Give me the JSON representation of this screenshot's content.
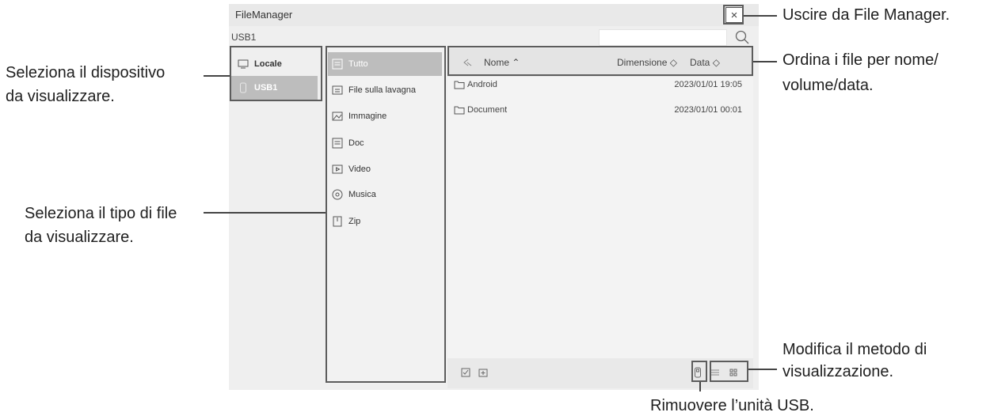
{
  "window": {
    "title": "FileManager",
    "close_label": "×",
    "path": "USB1"
  },
  "devices": [
    {
      "label": "Locale",
      "icon": "monitor-icon",
      "selected": false
    },
    {
      "label": "USB1",
      "icon": "usb-drive-icon",
      "selected": true
    }
  ],
  "categories": [
    {
      "label": "Tutto",
      "icon": "all-files-icon",
      "selected": true
    },
    {
      "label": "File sulla lavagna",
      "icon": "whiteboard-file-icon",
      "selected": false
    },
    {
      "label": "Immagine",
      "icon": "image-icon",
      "selected": false
    },
    {
      "label": "Doc",
      "icon": "doc-icon",
      "selected": false
    },
    {
      "label": "Video",
      "icon": "video-icon",
      "selected": false
    },
    {
      "label": "Musica",
      "icon": "music-icon",
      "selected": false
    },
    {
      "label": "Zip",
      "icon": "zip-icon",
      "selected": false
    }
  ],
  "file_header": {
    "name": "Nome",
    "size": "Dimensione",
    "date": "Data"
  },
  "files": [
    {
      "name": "Android",
      "date": "2023/01/01 19:05"
    },
    {
      "name": "Document",
      "date": "2023/01/01 00:01"
    }
  ],
  "annotations": {
    "exit": "Uscire da File Manager.",
    "sort": [
      "Ordina i file per nome/",
      "volume/data."
    ],
    "device": [
      "Seleziona il dispositivo",
      "da visualizzare."
    ],
    "type": [
      "Seleziona il tipo di file",
      "da visualizzare."
    ],
    "view": [
      "Modifica il metodo di",
      "visualizzazione."
    ],
    "usb": "Rimuovere l’unità USB."
  },
  "colors": {
    "selected_bg": "#bdbdbd",
    "window_bg": "#efefef",
    "callout_box": "#5c5c5c"
  }
}
